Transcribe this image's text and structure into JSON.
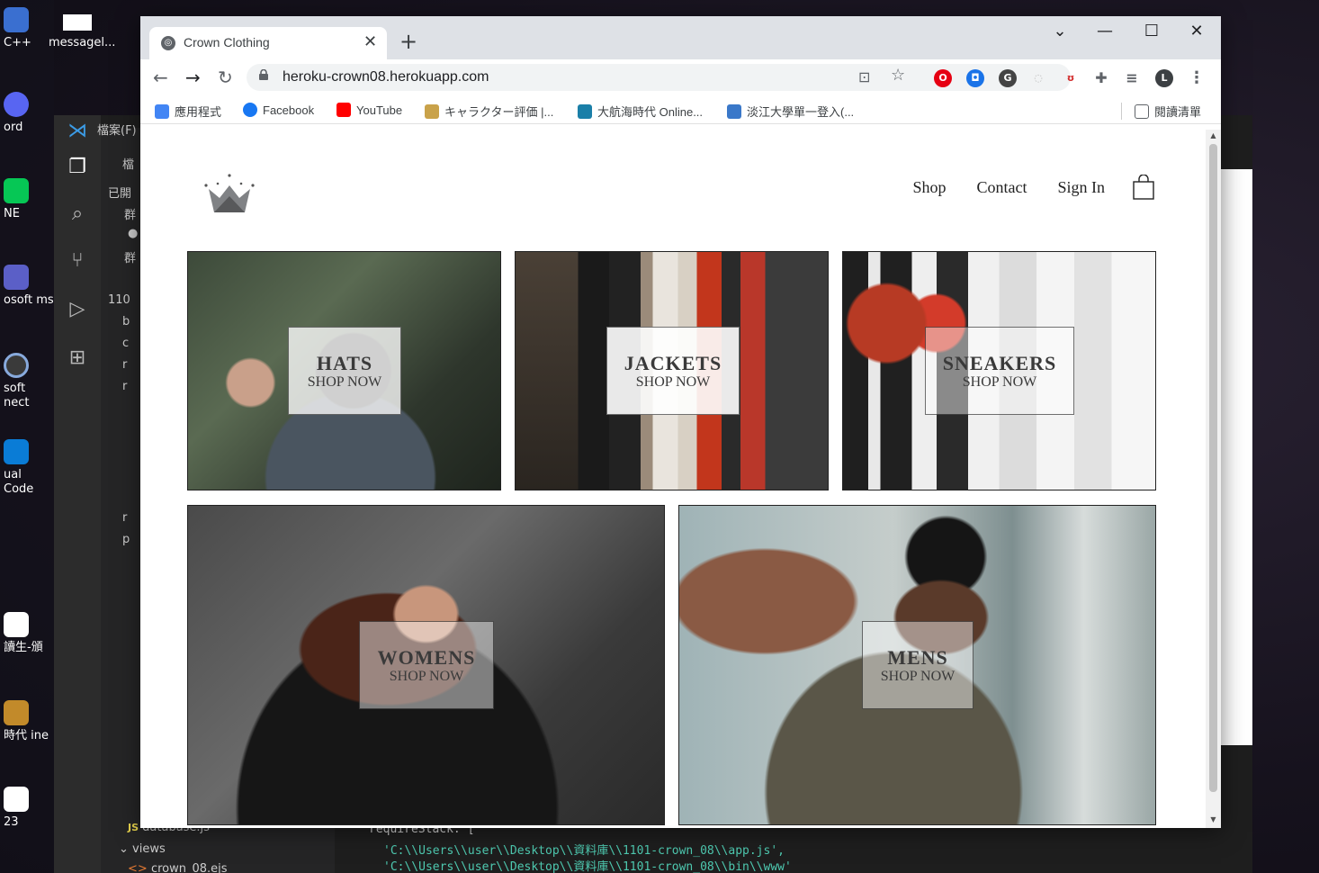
{
  "desktop": {
    "icons": [
      {
        "label": "C++"
      },
      {
        "label": "ord"
      },
      {
        "label": "NE"
      },
      {
        "label": "osoft ms"
      },
      {
        "label": "soft nect"
      },
      {
        "label": "ual Code"
      },
      {
        "label": "讀生-頒"
      },
      {
        "label": "時代 ine"
      },
      {
        "label": "23"
      }
    ],
    "top_icon_label": "messagel..."
  },
  "vscode": {
    "menu_label": "檔案(F)",
    "sidebar_rows": [
      "檔",
      "已開",
      "群",
      "●",
      "群",
      "110",
      "b",
      "c",
      "r",
      "r",
      "r",
      "p"
    ],
    "database_file": "database.js",
    "views_label": "views",
    "ejs_file": "crown_08.ejs",
    "terminal_lines": [
      "requireStack: [",
      "'C:\\\\Users\\\\user\\\\Desktop\\\\資料庫\\\\1101-crown_08\\\\app.js',",
      "'C:\\\\Users\\\\user\\\\Desktop\\\\資料庫\\\\1101-crown_08\\\\bin\\\\www'"
    ]
  },
  "browser": {
    "tab_title": "Crown Clothing",
    "url": "heroku-crown08.herokuapp.com",
    "profile_initial": "L",
    "bookmarks": [
      {
        "label": "應用程式",
        "color": "#4285f4"
      },
      {
        "label": "Facebook",
        "color": "#1877f2"
      },
      {
        "label": "YouTube",
        "color": "#ff0000"
      },
      {
        "label": "キャラクター評価 |...",
        "color": "#c9a24a"
      },
      {
        "label": "大航海時代 Online...",
        "color": "#1a7fa8"
      },
      {
        "label": "淡江大學單一登入(...",
        "color": "#3a78c9"
      }
    ],
    "reading_list": "閱讀清單"
  },
  "site": {
    "nav": {
      "shop": "Shop",
      "contact": "Contact",
      "sign_in": "Sign In"
    },
    "categories": [
      {
        "title": "HATS",
        "subtitle": "SHOP NOW"
      },
      {
        "title": "JACKETS",
        "subtitle": "SHOP NOW"
      },
      {
        "title": "SNEAKERS",
        "subtitle": "SHOP NOW"
      },
      {
        "title": "WOMENS",
        "subtitle": "SHOP NOW"
      },
      {
        "title": "MENS",
        "subtitle": "SHOP NOW"
      }
    ]
  },
  "colors": {
    "chrome_tabbar": "#dee1e6",
    "page_bg": "#ffffff",
    "tile_box": "#ffffff",
    "accent_text": "#222222"
  }
}
